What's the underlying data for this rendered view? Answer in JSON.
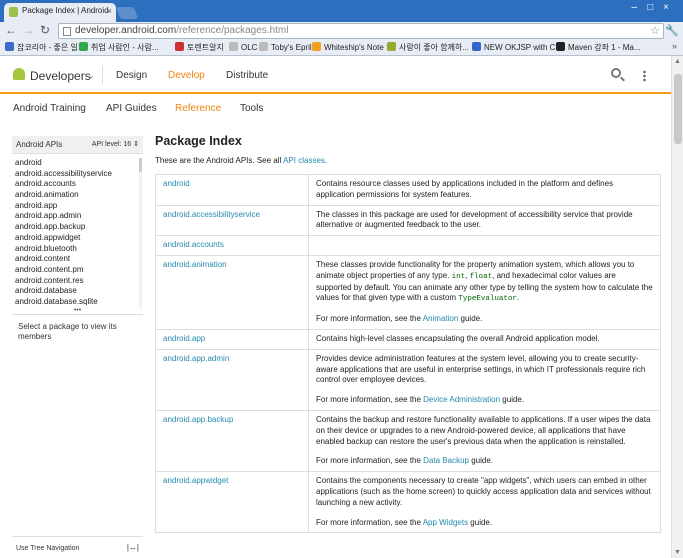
{
  "browser": {
    "tab_title": "Package Index | Android",
    "url_host": "developer.android.com",
    "url_path": "/reference/packages.html",
    "bookmarks": [
      {
        "label": "잡코리아 - 좋은 일...",
        "color": "#3b6cc9"
      },
      {
        "label": "취업 사람인 - 사람...",
        "color": "#2fa84f"
      },
      {
        "label": "토렌트알지",
        "color": "#c33"
      },
      {
        "label": "OLC",
        "color": "#bbb"
      },
      {
        "label": "Toby's Epril",
        "color": "#bbb"
      },
      {
        "label": "Whiteship's Note ::",
        "color": "#f0a020"
      },
      {
        "label": "사랑이 좋아 함께하...",
        "color": "#9a3"
      },
      {
        "label": "NEW OKJSP with C...",
        "color": "#36c"
      },
      {
        "label": "Maven 강좌 1 - Ma...",
        "color": "#222"
      }
    ]
  },
  "header": {
    "brand": "Developers",
    "nav": [
      "Design",
      "Develop",
      "Distribute"
    ],
    "active_nav": "Develop"
  },
  "subnav": {
    "items": [
      "Android Training",
      "API Guides",
      "Reference",
      "Tools"
    ],
    "active": "Reference"
  },
  "sidebar": {
    "title": "Android APIs",
    "api_level_label": "API level:",
    "api_level_value": "16",
    "packages": [
      "android",
      "android.accessibilityservice",
      "android.accounts",
      "android.animation",
      "android.app",
      "android.app.admin",
      "android.app.backup",
      "android.appwidget",
      "android.bluetooth",
      "android.content",
      "android.content.pm",
      "android.content.res",
      "android.database",
      "android.database.sqlite"
    ],
    "message": "Select a package to view its members",
    "footer": "Use Tree Navigation"
  },
  "main": {
    "title": "Package Index",
    "intro_text": "These are the Android APIs. See all ",
    "intro_link": "API classes",
    "intro_end": ".",
    "rows": [
      {
        "name": "android",
        "desc": "Contains resource classes used by applications included in the platform and defines application permissions for system features."
      },
      {
        "name": "android.accessibilityservice",
        "desc": "The classes in this package are used for development of accessibility service that provide alternative or augmented feedback to the user."
      },
      {
        "name": "android.accounts",
        "desc": ""
      },
      {
        "name": "android.animation",
        "desc": "These classes provide functionality for the property animation system, which allows you to animate object properties of any type.",
        "code1": "int",
        "code2": "float",
        "desc2": "and hexadecimal color values are supported by default. You can animate any other type by telling the system how to calculate the values for that given type with a custom",
        "code3": "TypeEvaluator",
        "more_pre": "For more information, see the ",
        "more_link": "Animation",
        "more_post": " guide."
      },
      {
        "name": "android.app",
        "desc": "Contains high-level classes encapsulating the overall Android application model."
      },
      {
        "name": "android.app.admin",
        "desc": "Provides device administration features at the system level, allowing you to create security-aware applications that are useful in enterprise settings, in which IT professionals require rich control over employee devices.",
        "more_pre": "For more information, see the ",
        "more_link": "Device Administration",
        "more_post": " guide."
      },
      {
        "name": "android.app.backup",
        "desc": "Contains the backup and restore functionality available to applications. If a user wipes the data on their device or upgrades to a new Android-powered device, all applications that have enabled backup can restore the user's previous data when the application is reinstalled.",
        "more_pre": "For more information, see the ",
        "more_link": "Data Backup",
        "more_post": " guide."
      },
      {
        "name": "android.appwidget",
        "desc": "Contains the components necessary to create \"app widgets\", which users can embed in other applications (such as the home screen) to quickly access application data and services without launching a new activity.",
        "more_pre": "For more information, see the ",
        "more_link": "App Widgets",
        "more_post": " guide."
      }
    ]
  }
}
